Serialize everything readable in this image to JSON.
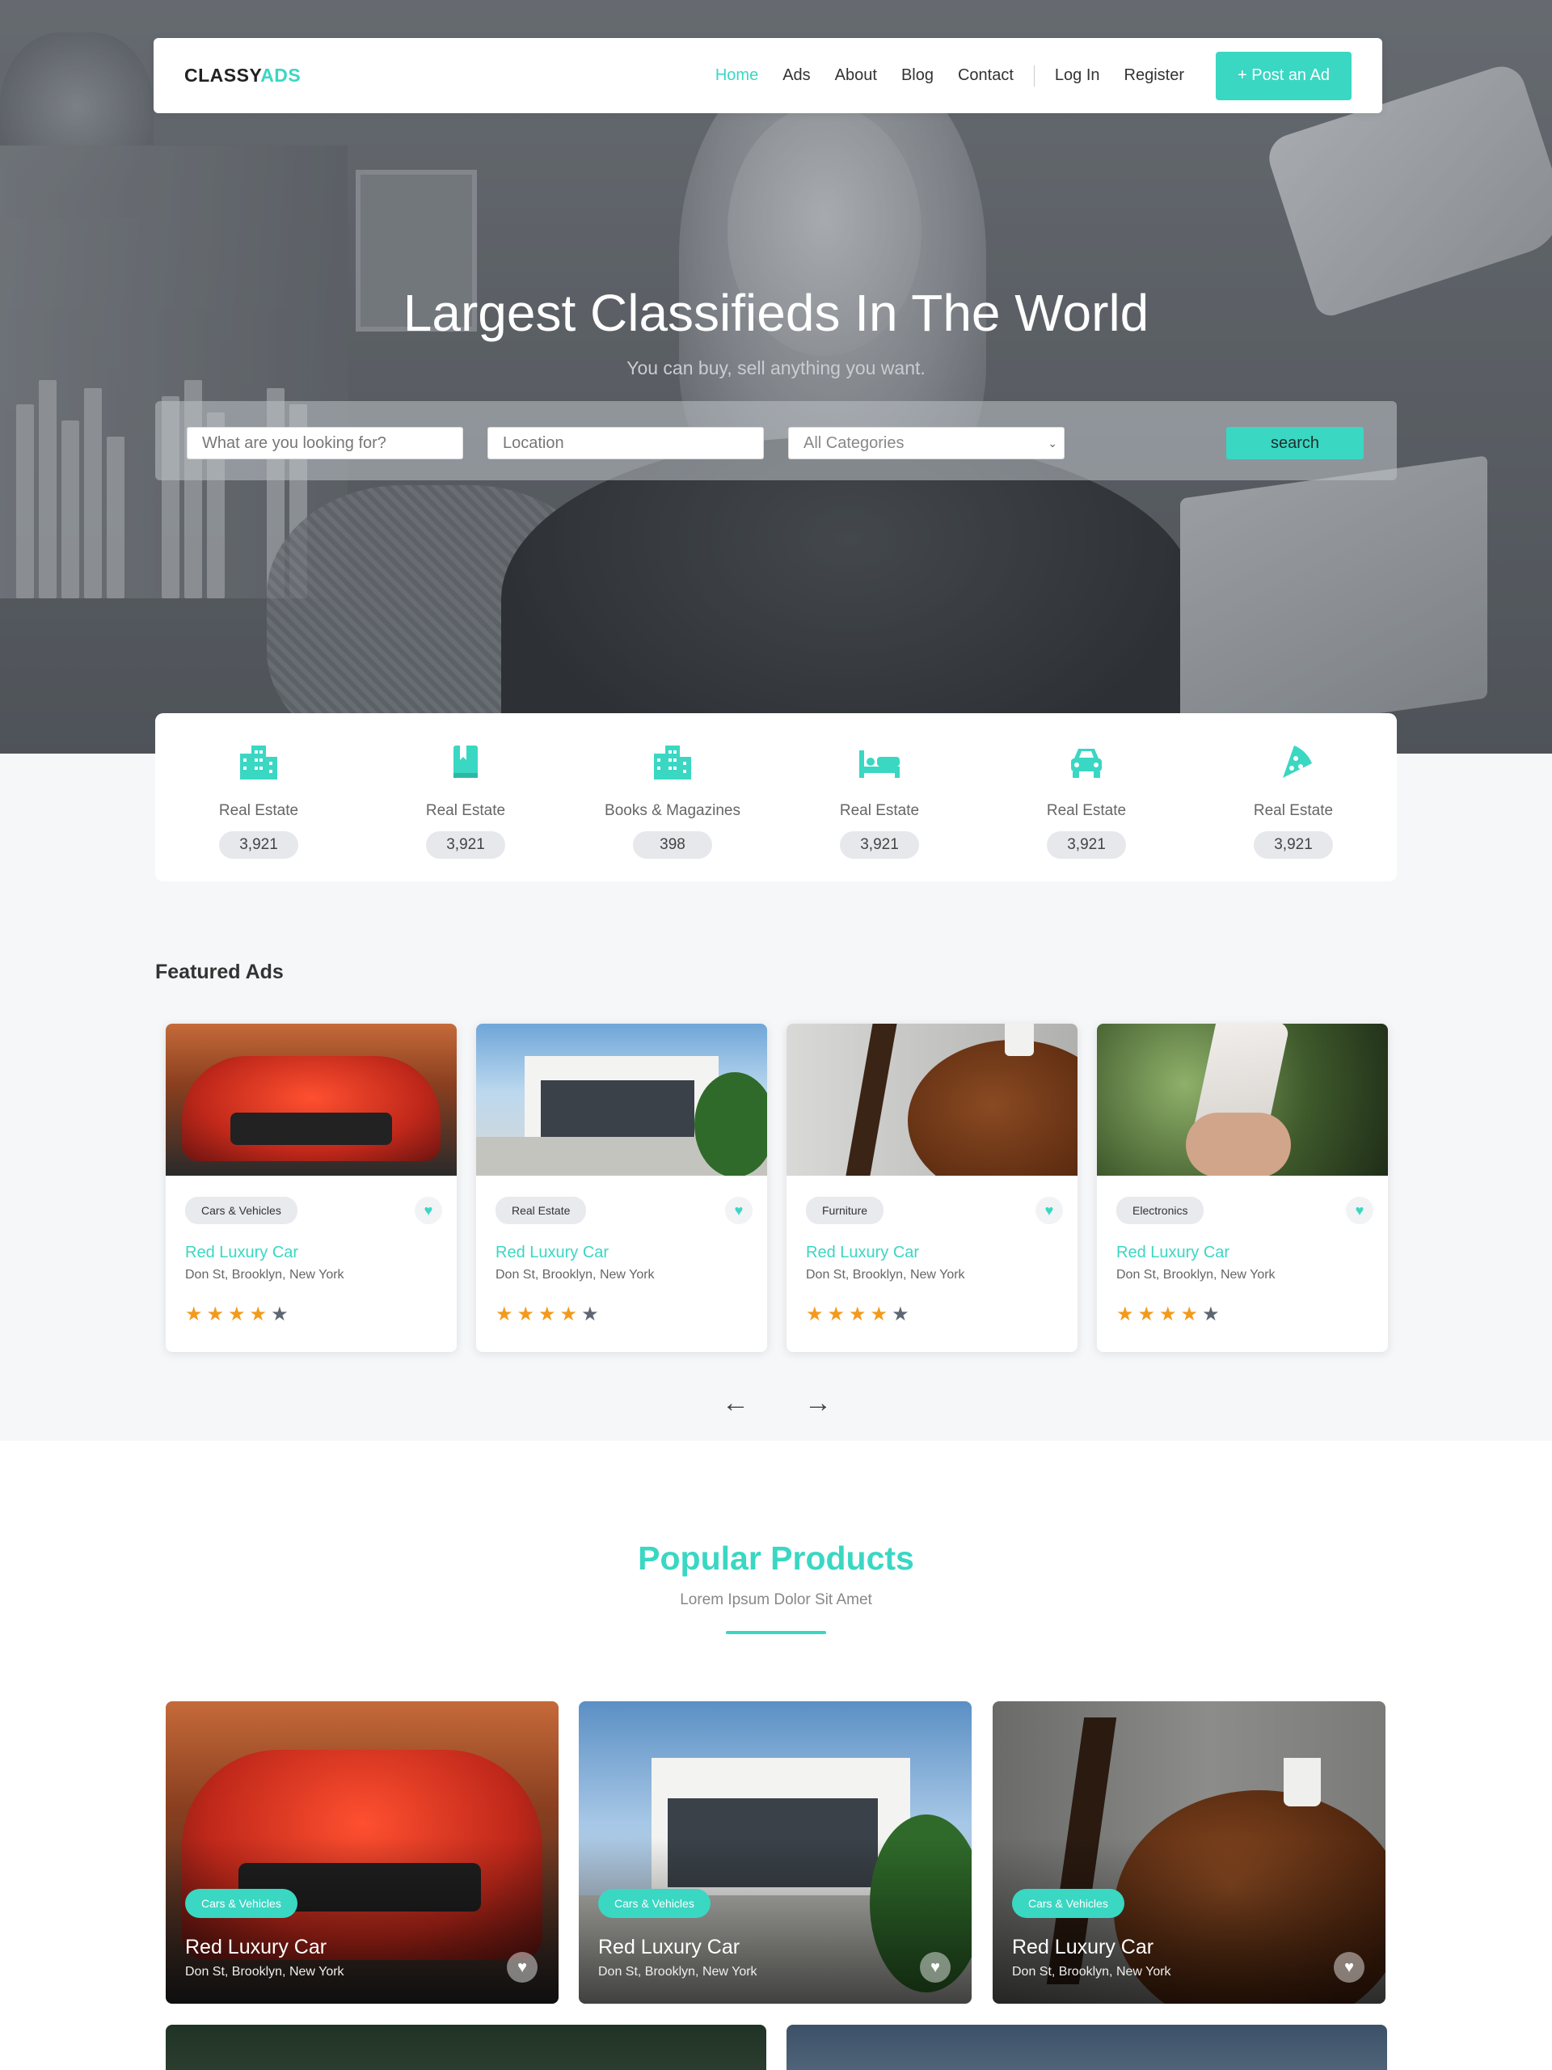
{
  "brand": {
    "logo_main": "CLASSY",
    "logo_accent": "ADS"
  },
  "nav": {
    "items": [
      {
        "label": "Home",
        "active": true
      },
      {
        "label": "Ads"
      },
      {
        "label": "About"
      },
      {
        "label": "Blog"
      },
      {
        "label": "Contact"
      }
    ],
    "login": "Log In",
    "register": "Register",
    "post_ad": "+ Post an Ad"
  },
  "hero": {
    "title": "Largest Classifieds In The World",
    "subtitle": "You can buy, sell anything you want."
  },
  "search": {
    "keyword_placeholder": "What are you looking for?",
    "location_placeholder": "Location",
    "category_selected": "All Categories",
    "button": "search"
  },
  "categories": [
    {
      "label": "Real Estate",
      "count": "3,921",
      "icon": "building-icon"
    },
    {
      "label": "Real Estate",
      "count": "3,921",
      "icon": "book-icon"
    },
    {
      "label": "Books & Magazines",
      "count": "398",
      "icon": "building-icon"
    },
    {
      "label": "Real Estate",
      "count": "3,921",
      "icon": "bed-icon"
    },
    {
      "label": "Real Estate",
      "count": "3,921",
      "icon": "car-icon"
    },
    {
      "label": "Real Estate",
      "count": "3,921",
      "icon": "pizza-icon"
    }
  ],
  "featured": {
    "title": "Featured Ads",
    "cards": [
      {
        "tag": "Cars & Vehicles",
        "title": "Red Luxury Car",
        "location": "Don St, Brooklyn, New York",
        "rating": 4
      },
      {
        "tag": "Real Estate",
        "title": "Red Luxury Car",
        "location": "Don St, Brooklyn, New York",
        "rating": 4
      },
      {
        "tag": "Furniture",
        "title": "Red Luxury Car",
        "location": "Don St, Brooklyn, New York",
        "rating": 4
      },
      {
        "tag": "Electronics",
        "title": "Red Luxury Car",
        "location": "Don St, Brooklyn, New York",
        "rating": 4
      }
    ],
    "prev": "←",
    "next": "→"
  },
  "popular": {
    "title": "Popular Products",
    "subtitle": "Lorem Ipsum Dolor Sit Amet",
    "cards": [
      {
        "tag": "Cars & Vehicles",
        "title": "Red Luxury Car",
        "location": "Don St, Brooklyn, New York"
      },
      {
        "tag": "Cars & Vehicles",
        "title": "Red Luxury Car",
        "location": "Don St, Brooklyn, New York"
      },
      {
        "tag": "Cars & Vehicles",
        "title": "Red Luxury Car",
        "location": "Don St, Brooklyn, New York"
      }
    ]
  },
  "colors": {
    "accent": "#3ad7c3",
    "star": "#f39a1d",
    "star_off": "#5d6773"
  }
}
